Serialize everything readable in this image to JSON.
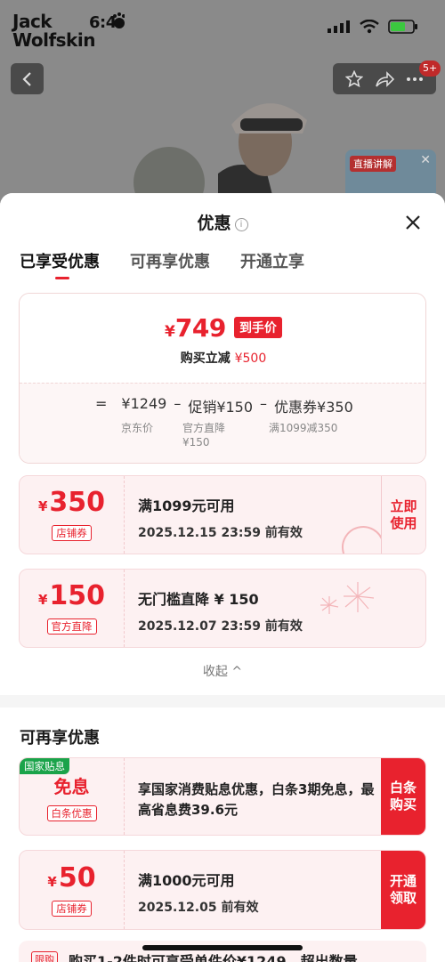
{
  "status_bar": {
    "brand_line1": "Jack",
    "brand_line2": "Wolfskin"
  },
  "background": {
    "notification_count": "5+",
    "live_label": "直播讲解"
  },
  "sheet": {
    "title": "优惠",
    "info_icon": "i",
    "tabs": [
      "已享受优惠",
      "可再享优惠",
      "开通立享"
    ]
  },
  "summary": {
    "currency": "¥",
    "final_price": "749",
    "final_price_tag": "到手价",
    "cut_label": "购买立减",
    "cut_amount": "¥500",
    "calc_eq": "=",
    "jd_price": "¥1249",
    "minus": "–",
    "promo": "促销¥150",
    "coupon": "优惠券¥350",
    "jd_price_label": "京东价",
    "promo_sub": "官方直降\n¥150",
    "coupon_sub": "满1099减350"
  },
  "coupons": [
    {
      "currency": "¥",
      "amount": "350",
      "label": "店铺券",
      "line1": "满1099元可用",
      "line2": "2025.12.15 23:59 前有效",
      "action": "立即\n使用"
    },
    {
      "currency": "¥",
      "amount": "150",
      "label": "官方直降",
      "line1": "无门槛直降 ¥ 150",
      "line2": "2025.12.07 23:59 前有效"
    }
  ],
  "collapse_label": "收起 ^",
  "section2": {
    "title": "可再享优惠",
    "interest": {
      "badge": "国家贴息",
      "amount": "免息",
      "label": "白条优惠",
      "text": "享国家消费贴息优惠，白条3期免息，最高省息费39.6元",
      "action": "白条\n购买"
    },
    "coupon50": {
      "currency": "¥",
      "amount": "50",
      "label": "店铺券",
      "line1": "满1000元可用",
      "line2": "2025.12.05 前有效",
      "action": "开通\n领取"
    },
    "peek_tag": "限购",
    "peek_text": "购买1-2件时可享受单件价¥1249，超出数量"
  },
  "colors": {
    "accent": "#e8222e",
    "green": "#1aa34a"
  }
}
